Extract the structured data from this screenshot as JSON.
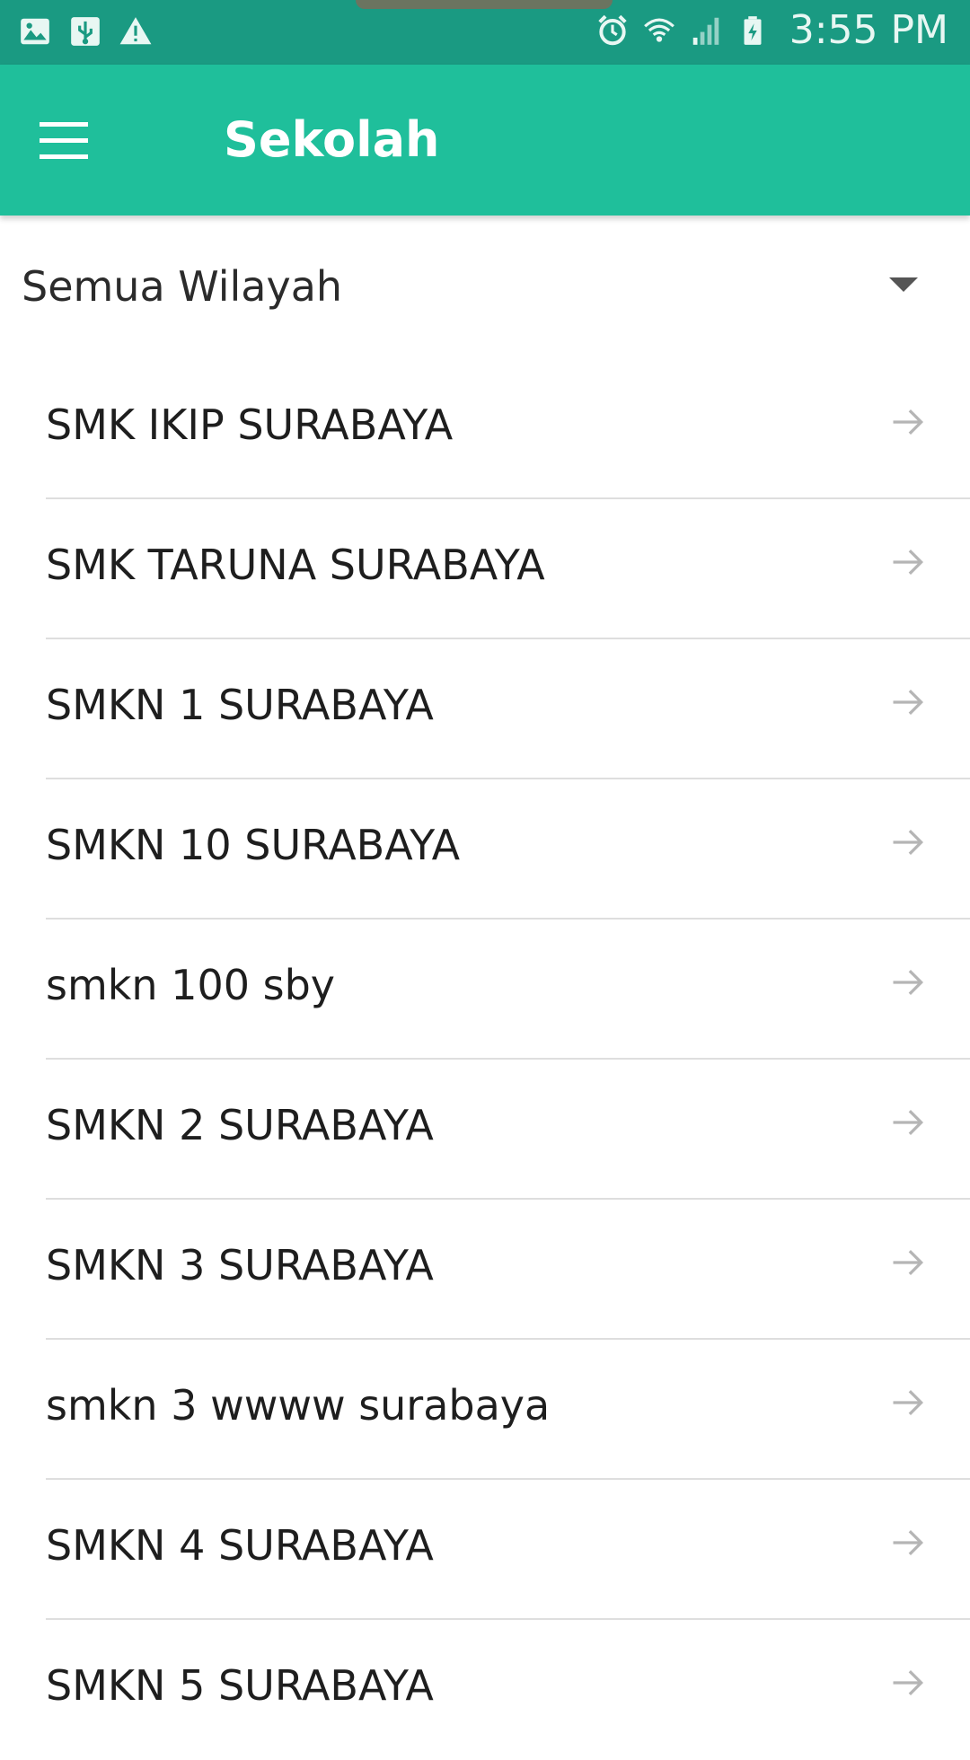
{
  "status_bar": {
    "time": "3:55 PM",
    "left_icons": [
      "image-icon",
      "usb-icon",
      "warning-icon"
    ],
    "right_icons": [
      "alarm-icon",
      "wifi-icon",
      "signal-icon",
      "battery-charging-icon"
    ]
  },
  "app_bar": {
    "title": "Sekolah",
    "menu_icon": "hamburger-menu-icon",
    "color": "#1fbf9b"
  },
  "filter": {
    "selected_region": "Semua Wilayah",
    "icon": "dropdown-arrow-icon"
  },
  "schools": [
    {
      "name": "SMK IKIP SURABAYA"
    },
    {
      "name": "SMK TARUNA SURABAYA"
    },
    {
      "name": "SMKN 1 SURABAYA"
    },
    {
      "name": "SMKN 10 SURABAYA"
    },
    {
      "name": "smkn 100 sby"
    },
    {
      "name": "SMKN 2 SURABAYA"
    },
    {
      "name": "SMKN 3 SURABAYA"
    },
    {
      "name": "smkn 3 wwww surabaya"
    },
    {
      "name": "SMKN 4 SURABAYA"
    },
    {
      "name": "SMKN 5 SURABAYA"
    }
  ],
  "colors": {
    "status_bar": "#1a9a82",
    "primary": "#1fbf9b",
    "divider": "#dedede",
    "arrow": "#b5b5b5"
  }
}
